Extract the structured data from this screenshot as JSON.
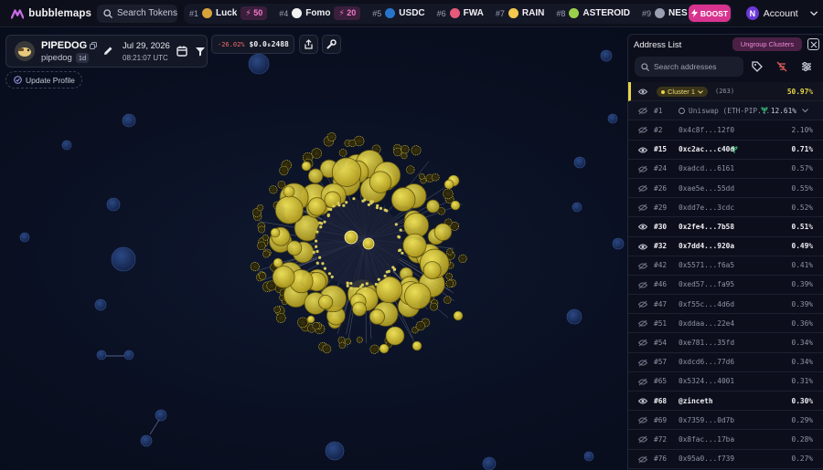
{
  "app": {
    "name": "bubblemaps"
  },
  "colors": {
    "accent": "#d8348f",
    "cluster": "#e7d44a",
    "negative": "#f06a6a",
    "bg": "#0a1022"
  },
  "topbar": {
    "search_label": "Search Tokens",
    "ticker": [
      {
        "rank": "#1",
        "name": "Luck",
        "boost": "50",
        "icon": "luck-icon",
        "color": "#d9a23a"
      },
      {
        "rank": "#4",
        "name": "Fomo",
        "boost": "20",
        "icon": "fomo-icon",
        "color": "#f2f2f2"
      },
      {
        "rank": "#5",
        "name": "USDC",
        "icon": "usdc-icon",
        "color": "#2775ca"
      },
      {
        "rank": "#6",
        "name": "FWA",
        "icon": "fwa-icon",
        "color": "#e65a7a"
      },
      {
        "rank": "#7",
        "name": "RAIN",
        "icon": "rain-icon",
        "color": "#f2c94c"
      },
      {
        "rank": "#8",
        "name": "ASTEROID",
        "icon": "asteroid-icon",
        "color": "#9bd14a"
      },
      {
        "rank": "#9",
        "name": "NES",
        "icon": "nes-icon",
        "color": "#9aa0b2"
      }
    ],
    "boost_label": "BOOST",
    "account_label": "Account",
    "account_initial": "N"
  },
  "token": {
    "symbol": "PIPEDOG",
    "name": "pipedog",
    "age": "1d",
    "date": "Jul 29, 2026",
    "time": "08:21:07 UTC",
    "price_change": "-26.02%",
    "price": "$0.0₈2488",
    "update_profile_label": "Update Profile"
  },
  "panel": {
    "title": "Address List",
    "ungroup_label": "Ungroup Clusters",
    "search_placeholder": "Search addresses",
    "cluster_row": {
      "label": "Cluster 1",
      "count": "(263)",
      "pct": "50.97%"
    },
    "rows": [
      {
        "rank": "#1",
        "addr": "Uniswap (ETH-PIP...",
        "pct": "12.61%",
        "bold": false,
        "sub": true
      },
      {
        "rank": "#2",
        "addr": "0x4c8f...12f0",
        "pct": "2.10%",
        "bold": false
      },
      {
        "rank": "#15",
        "addr": "0xc2ac...c40d",
        "pct": "0.71%",
        "bold": true
      },
      {
        "rank": "#24",
        "addr": "0xadcd...6161",
        "pct": "0.57%",
        "bold": false
      },
      {
        "rank": "#26",
        "addr": "0xae5e...55dd",
        "pct": "0.55%",
        "bold": false
      },
      {
        "rank": "#29",
        "addr": "0xdd7e...3cdc",
        "pct": "0.52%",
        "bold": false
      },
      {
        "rank": "#30",
        "addr": "0x2fe4...7b58",
        "pct": "0.51%",
        "bold": true
      },
      {
        "rank": "#32",
        "addr": "0x7dd4...920a",
        "pct": "0.49%",
        "bold": true
      },
      {
        "rank": "#42",
        "addr": "0x5571...f6a5",
        "pct": "0.41%",
        "bold": false
      },
      {
        "rank": "#46",
        "addr": "0xed57...fa95",
        "pct": "0.39%",
        "bold": false
      },
      {
        "rank": "#47",
        "addr": "0xf55c...4d6d",
        "pct": "0.39%",
        "bold": false
      },
      {
        "rank": "#51",
        "addr": "0xddaa...22e4",
        "pct": "0.36%",
        "bold": false
      },
      {
        "rank": "#54",
        "addr": "0xe781...35fd",
        "pct": "0.34%",
        "bold": false
      },
      {
        "rank": "#57",
        "addr": "0xdcd6...77d6",
        "pct": "0.34%",
        "bold": false
      },
      {
        "rank": "#65",
        "addr": "0x5324...4001",
        "pct": "0.31%",
        "bold": false
      },
      {
        "rank": "#68",
        "addr": "@zinceth",
        "pct": "0.30%",
        "bold": true
      },
      {
        "rank": "#69",
        "addr": "0x7359...0d7b",
        "pct": "0.29%",
        "bold": false
      },
      {
        "rank": "#72",
        "addr": "0x8fac...17ba",
        "pct": "0.28%",
        "bold": false
      },
      {
        "rank": "#76",
        "addr": "0x95a0...f739",
        "pct": "0.27%",
        "bold": false
      }
    ]
  }
}
